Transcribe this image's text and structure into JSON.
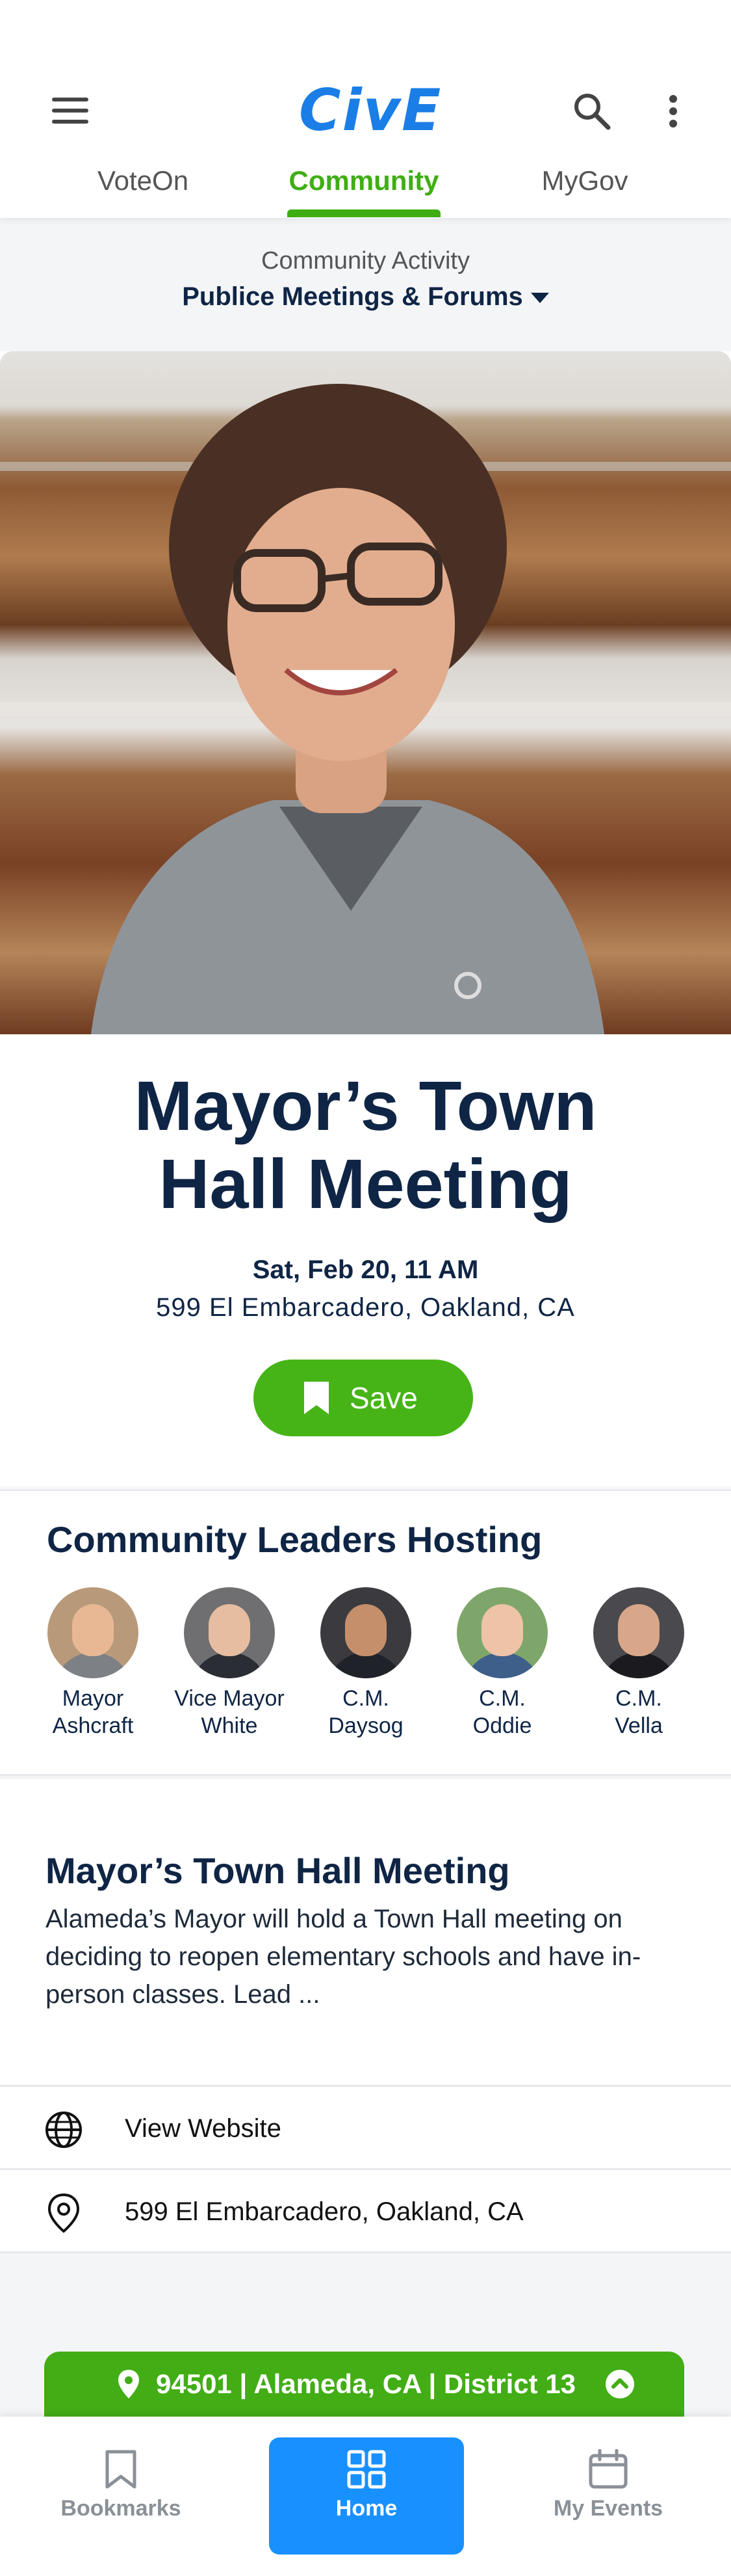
{
  "header": {
    "logo_text": "CivE",
    "tabs": [
      {
        "label": "VoteOn"
      },
      {
        "label": "Community"
      },
      {
        "label": "MyGov"
      }
    ]
  },
  "activity": {
    "label": "Community Activity",
    "selected": "Publice Meetings & Forums"
  },
  "event": {
    "title_line1": "Mayor’s Town",
    "title_line2": "Hall Meeting",
    "date": "Sat, Feb 20, 11 AM",
    "address": "599 El Embarcadero, Oakland, CA",
    "save_label": "Save"
  },
  "leaders": {
    "title": "Community Leaders Hosting",
    "items": [
      {
        "line1": "Mayor",
        "line2": "Ashcraft"
      },
      {
        "line1": "Vice Mayor",
        "line2": "White"
      },
      {
        "line1": "C.M.",
        "line2": "Daysog"
      },
      {
        "line1": "C.M.",
        "line2": "Oddie"
      },
      {
        "line1": "C.M.",
        "line2": "Vella"
      }
    ]
  },
  "description": {
    "title": "Mayor’s Town Hall Meeting",
    "body": "Alameda’s Mayor will hold a Town Hall meeting on deciding to reopen elementary schools and have in-person classes. Lead ..."
  },
  "info_rows": {
    "website": "View Website",
    "location": "599 El Embarcadero, Oakland, CA"
  },
  "location_bar": {
    "text": "94501 | Alameda, CA | District 13"
  },
  "bottom_nav": {
    "bookmarks": "Bookmarks",
    "home": "Home",
    "events": "My Events"
  },
  "colors": {
    "brand_blue": "#1a7ee6",
    "accent_green": "#46b416",
    "navy": "#0f2545",
    "home_blue": "#1890ff"
  }
}
